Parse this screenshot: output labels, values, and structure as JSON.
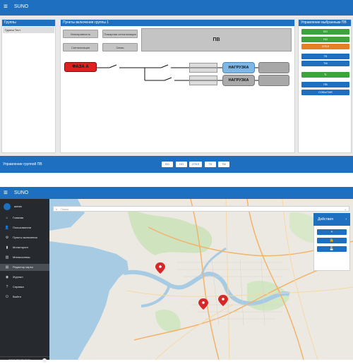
{
  "top": {
    "app_title": "SUNO",
    "groups_panel": {
      "title": "Группы",
      "selected_item": "Группа Тест"
    },
    "points_panel": {
      "title": "Пункты включения группы 1",
      "buttons": [
        "Неисправность",
        "Пожарная сигнализация",
        "Сигнализация",
        "Связь"
      ],
      "pv_label": "ПВ",
      "faza_label": "ФАЗА А",
      "load_label_1": "НАГРУЗКА",
      "load_label_2": "НАГРУЗКА"
    },
    "control_panel": {
      "title": "Управление выбранным ПВ",
      "buttons": [
        {
          "label": "ВО",
          "color": "#3ea33e"
        },
        {
          "label": "НО",
          "color": "#3ea33e"
        },
        {
          "label": "ОТКЛ",
          "color": "#e67e22"
        },
        {
          "label": "ТК",
          "color": "#1e6fbf"
        },
        {
          "label": "ТМ",
          "color": "#1e6fbf"
        },
        {
          "label": "↻",
          "color": "#3ea33e"
        },
        {
          "label": "ПВ",
          "color": "#1e6fbf"
        },
        {
          "label": "СОБЫТИЕ",
          "color": "#1e6fbf"
        }
      ]
    },
    "group_control": {
      "label": "Управление группой ПВ",
      "buttons": [
        "ВО",
        "НО",
        "ОТКЛ",
        "ТК",
        "ТМ"
      ]
    }
  },
  "bottom": {
    "app_title": "SUNO",
    "user": "admin",
    "menu": [
      {
        "label": "Главная",
        "icon": "home-icon",
        "glyph": "⌂",
        "active": false
      },
      {
        "label": "Пользователи",
        "icon": "users-icon",
        "glyph": "👤",
        "active": false
      },
      {
        "label": "Пункты включения",
        "icon": "switch-points-icon",
        "glyph": "⚙",
        "active": false
      },
      {
        "label": "Мониторинг",
        "icon": "monitoring-icon",
        "glyph": "▮",
        "active": false
      },
      {
        "label": "Мнемосхемы",
        "icon": "mnemonic-icon",
        "glyph": "▥",
        "active": false
      },
      {
        "label": "Редактор карты",
        "icon": "map-editor-icon",
        "glyph": "▤",
        "active": true
      },
      {
        "label": "Журнал",
        "icon": "journal-icon",
        "glyph": "◉",
        "active": false
      },
      {
        "label": "Справка",
        "icon": "help-icon",
        "glyph": "?",
        "active": false
      },
      {
        "label": "Выйти",
        "icon": "logout-icon",
        "glyph": "⏻",
        "active": false
      }
    ],
    "footer": "ООО \"ПМГ\" 2021",
    "search_placeholder": "Поиск",
    "actions": {
      "title": "Действия",
      "buttons": [
        "+",
        "🔒",
        "💾"
      ]
    }
  }
}
